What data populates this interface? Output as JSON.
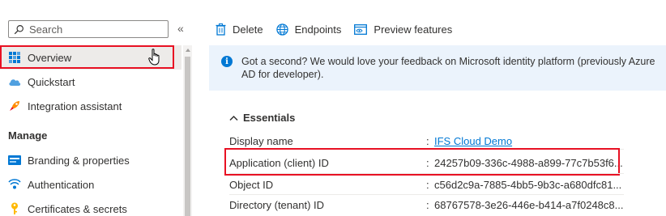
{
  "sidebar": {
    "search": {
      "placeholder": "Search"
    },
    "collapse_glyph": "«",
    "items": [
      {
        "label": "Overview",
        "icon": "grid-icon"
      },
      {
        "label": "Quickstart",
        "icon": "cloud-icon"
      },
      {
        "label": "Integration assistant",
        "icon": "rocket-icon"
      }
    ],
    "section": "Manage",
    "manage_items": [
      {
        "label": "Branding & properties",
        "icon": "branding-icon"
      },
      {
        "label": "Authentication",
        "icon": "authentication-icon"
      },
      {
        "label": "Certificates & secrets",
        "icon": "key-icon"
      }
    ]
  },
  "toolbar": {
    "delete_label": "Delete",
    "endpoints_label": "Endpoints",
    "preview_label": "Preview features"
  },
  "banner": {
    "message": "Got a second? We would love your feedback on Microsoft identity platform (previously Azure AD for developer)."
  },
  "essentials": {
    "title": "Essentials",
    "rows": [
      {
        "label": "Display name",
        "value": "IFS Cloud Demo"
      },
      {
        "label": "Application (client) ID",
        "value": "24257b09-336c-4988-a899-77c7b53f6..."
      },
      {
        "label": "Object ID",
        "value": "c56d2c9a-7885-4bb5-9b3c-a680dfc81..."
      },
      {
        "label": "Directory (tenant) ID",
        "value": "68767578-3e26-446e-b414-a7f0248c8..."
      }
    ]
  },
  "colors": {
    "accent": "#0078d4",
    "highlight_border": "#e81123",
    "banner_bg": "#ebf3fc"
  }
}
